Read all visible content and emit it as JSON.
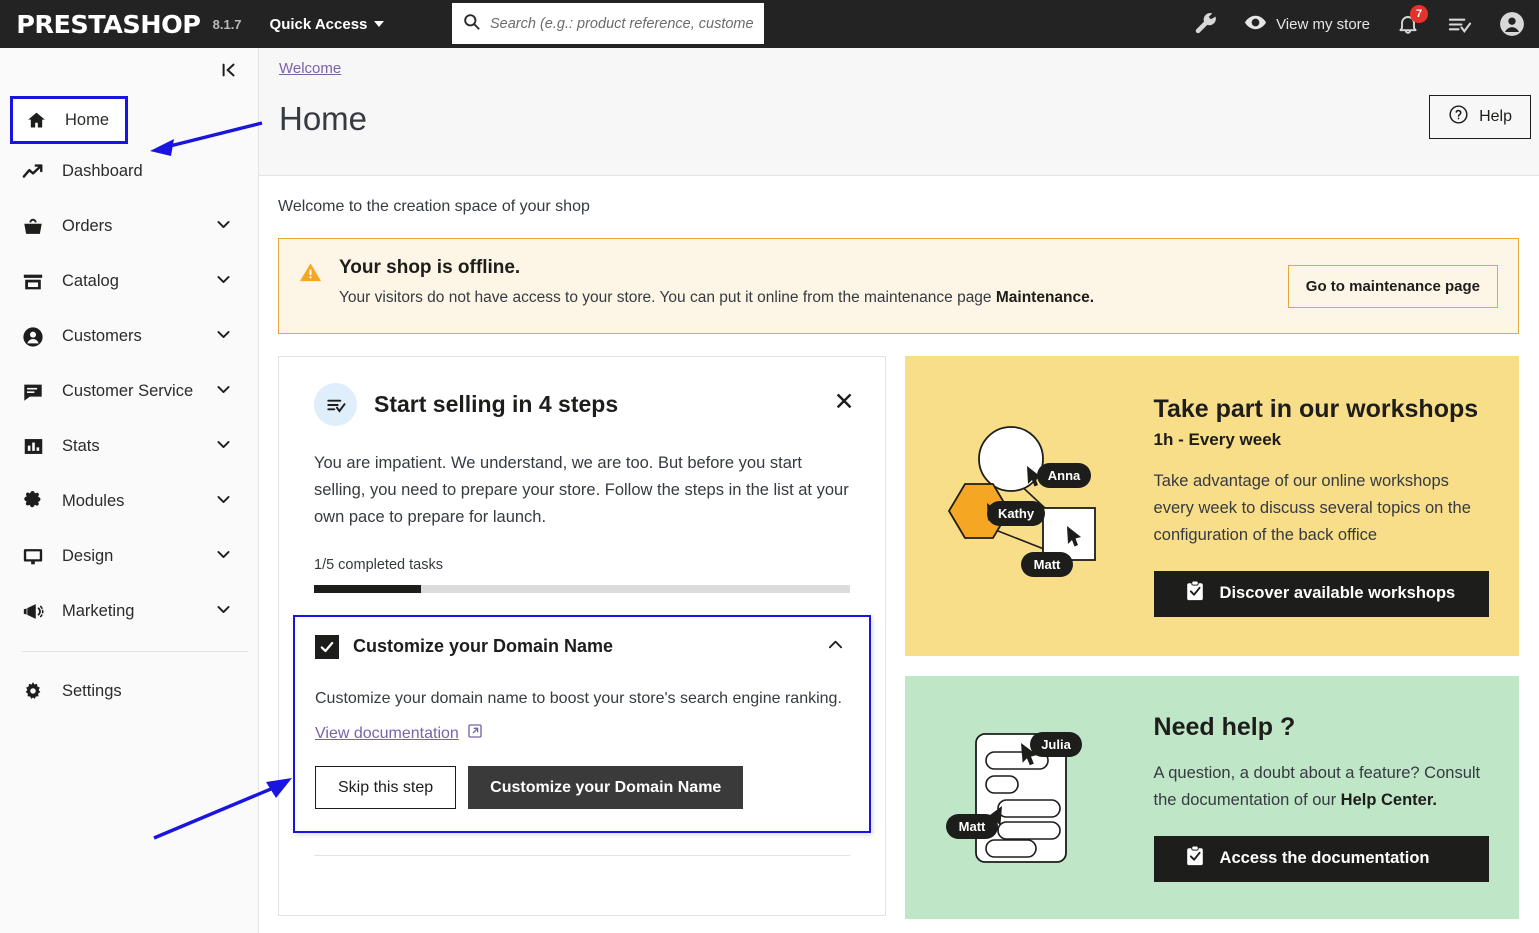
{
  "topbar": {
    "brand": "PRESTASHOP",
    "version": "8.1.7",
    "quick_access_label": "Quick Access",
    "search_placeholder": "Search (e.g.: product reference, customer...",
    "search_value": "",
    "view_store_label": "View my store",
    "notification_count": "7",
    "icons": {
      "wrench": "wrench-icon",
      "eye": "eye-icon",
      "bell": "bell-icon",
      "checklist": "checklist-icon",
      "avatar": "avatar-icon"
    }
  },
  "sidebar": {
    "collapse_label": "|<",
    "items": [
      {
        "label": "Home",
        "icon": "home-icon",
        "active": true,
        "has_submenu": false
      },
      {
        "label": "Dashboard",
        "icon": "trending-up-icon",
        "active": false,
        "has_submenu": false
      },
      {
        "label": "Orders",
        "icon": "basket-icon",
        "active": false,
        "has_submenu": true
      },
      {
        "label": "Catalog",
        "icon": "store-icon",
        "active": false,
        "has_submenu": true
      },
      {
        "label": "Customers",
        "icon": "person-icon",
        "active": false,
        "has_submenu": true
      },
      {
        "label": "Customer Service",
        "icon": "chat-icon",
        "active": false,
        "has_submenu": true
      },
      {
        "label": "Stats",
        "icon": "bar-chart-icon",
        "active": false,
        "has_submenu": true
      },
      {
        "label": "Modules",
        "icon": "puzzle-icon",
        "active": false,
        "has_submenu": true
      },
      {
        "label": "Design",
        "icon": "monitor-icon",
        "active": false,
        "has_submenu": true
      },
      {
        "label": "Marketing",
        "icon": "megaphone-icon",
        "active": false,
        "has_submenu": true
      }
    ],
    "settings": {
      "label": "Settings",
      "icon": "gear-icon"
    }
  },
  "page": {
    "breadcrumb": "Welcome",
    "title": "Home",
    "help_label": "Help",
    "welcome_line": "Welcome to the creation space of your shop"
  },
  "alert": {
    "title": "Your shop is offline.",
    "text_before": "Your visitors do not have access to your store. You can put it online from the maintenance page ",
    "text_bold": "Maintenance.",
    "button_label": "Go to maintenance page",
    "icon": "warning-triangle-icon"
  },
  "onboarding": {
    "icon": "checklist-icon",
    "title": "Start selling in 4 steps",
    "close_label": "✕",
    "description": "You are impatient. We understand, we are too. But before you start selling, you need to prepare your store. Follow the steps in the list at your own pace to prepare for launch.",
    "progress_label": "1/5 completed tasks",
    "progress_percent": 20,
    "step": {
      "title": "Customize your Domain Name",
      "checked": true,
      "description": "Customize your domain name to boost your store's search engine ranking.",
      "doc_link": "View documentation",
      "skip_label": "Skip this step",
      "primary_label": "Customize your Domain Name"
    }
  },
  "promo_workshops": {
    "title": "Take part in our workshops",
    "subtitle": "1h - Every week",
    "text": "Take advantage of our online workshops every week to discuss several topics on the configuration of the back office",
    "button_label": "Discover available workshops",
    "avatars": [
      "Anna",
      "Kathy",
      "Matt"
    ],
    "bg_color": "#f8de88"
  },
  "promo_help": {
    "title": "Need help ?",
    "text_before": "A question, a doubt about a feature? Consult the documentation of our ",
    "text_bold": "Help Center.",
    "button_label": "Access the documentation",
    "avatars": [
      "Julia",
      "Matt"
    ],
    "bg_color": "#bfe7c7"
  },
  "annotations": {
    "accent_color": "#1a14e0",
    "arrow_home": "arrow-pointing-to-home",
    "arrow_step": "arrow-pointing-to-domain-step"
  }
}
